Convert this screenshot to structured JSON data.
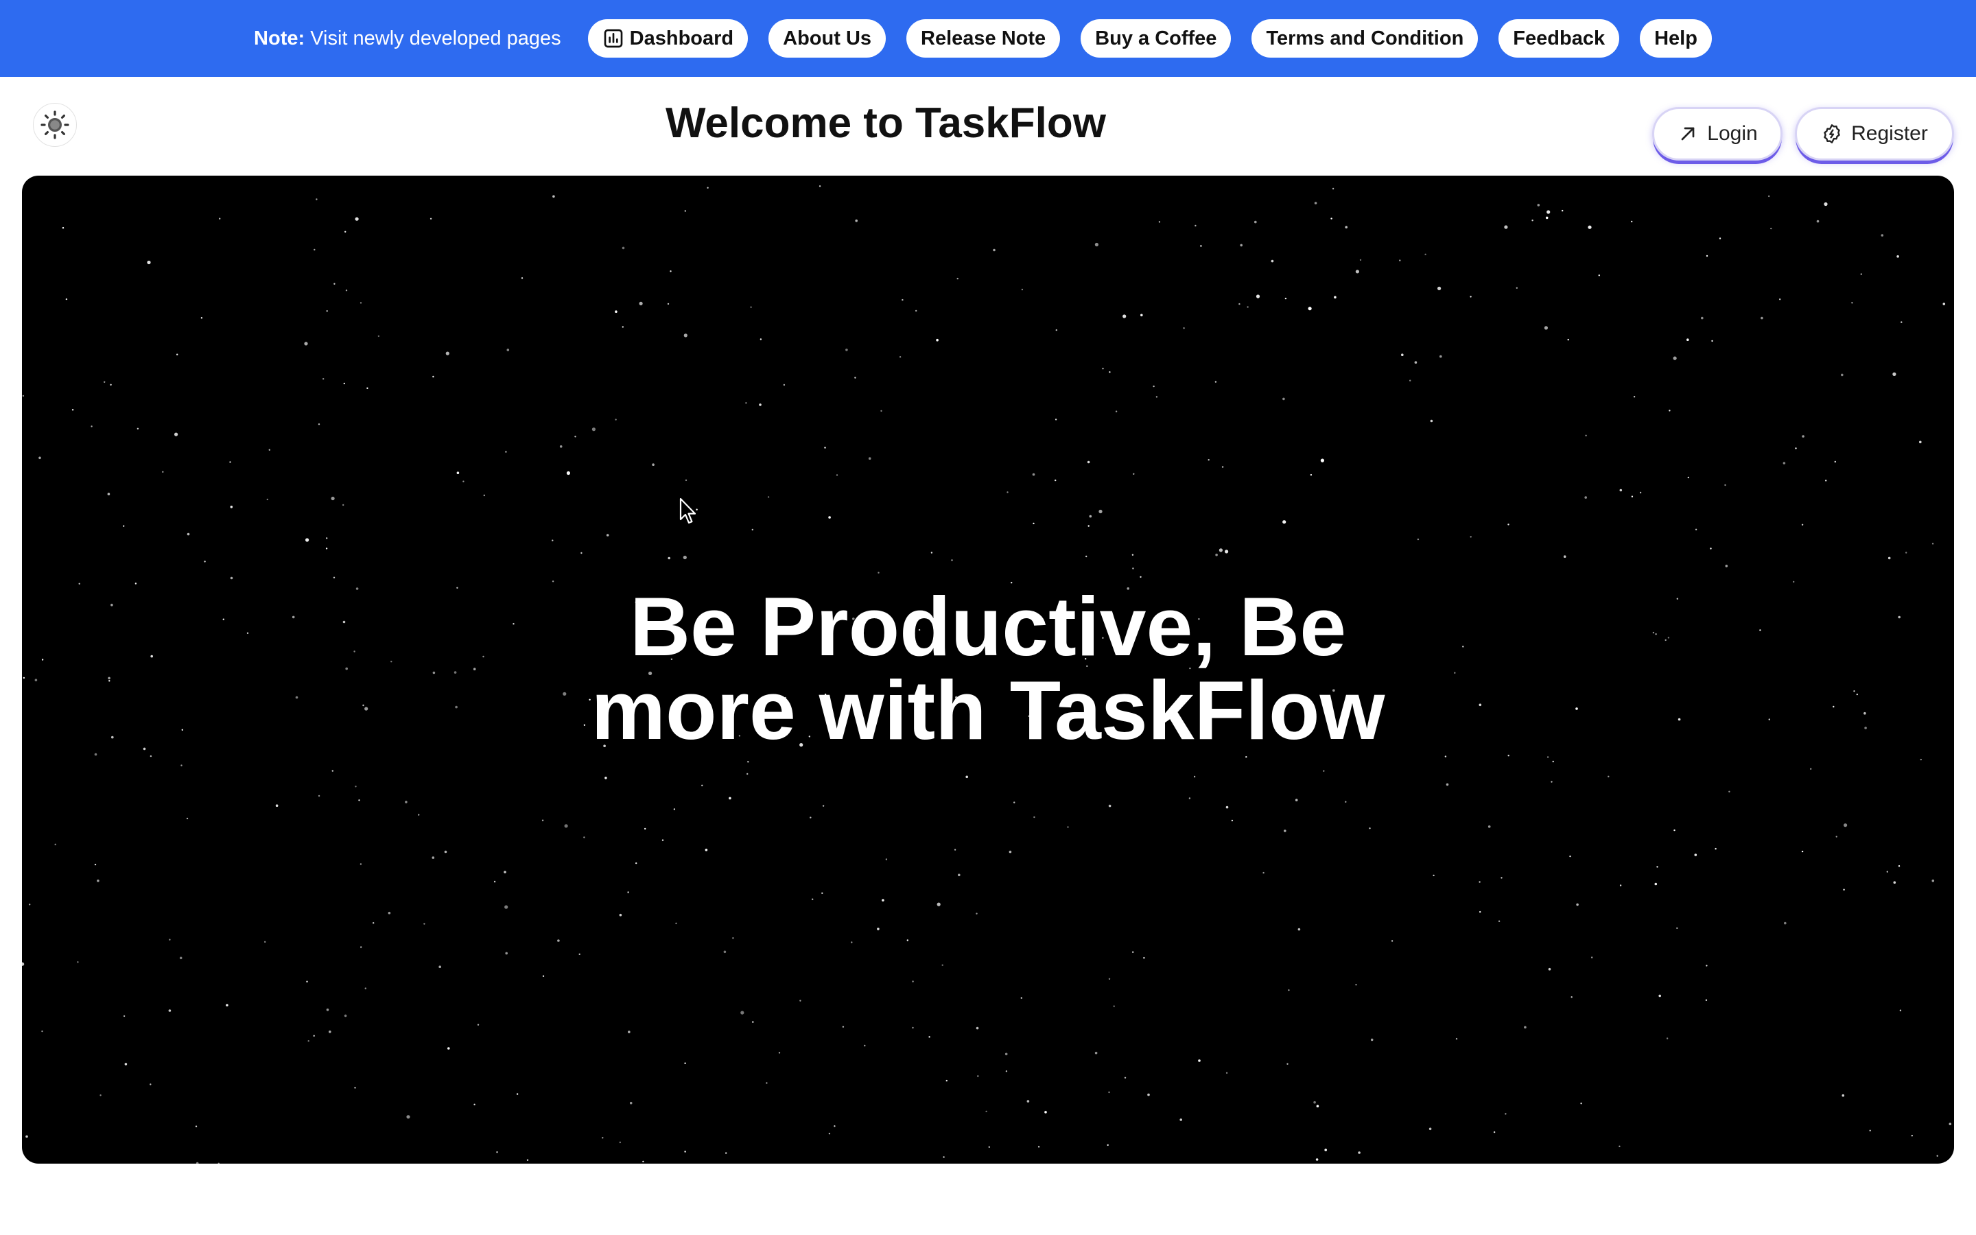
{
  "topbar": {
    "note_label": "Note:",
    "note_text": "Visit newly developed pages",
    "links": [
      {
        "label": "Dashboard",
        "icon": "bar-chart-icon"
      },
      {
        "label": "About Us"
      },
      {
        "label": "Release Note"
      },
      {
        "label": "Buy a Coffee"
      },
      {
        "label": "Terms and Condition"
      },
      {
        "label": "Feedback"
      },
      {
        "label": "Help"
      }
    ],
    "bg_color": "#2e6bf0"
  },
  "header": {
    "title": "Welcome to TaskFlow",
    "theme_icon": "sun-icon",
    "login_label": "Login",
    "login_icon": "arrow-up-right-icon",
    "register_label": "Register",
    "register_icon": "badge-icon"
  },
  "hero": {
    "line1": "Be Productive, Be",
    "line2": "more with TaskFlow",
    "bg_color": "#000000"
  }
}
